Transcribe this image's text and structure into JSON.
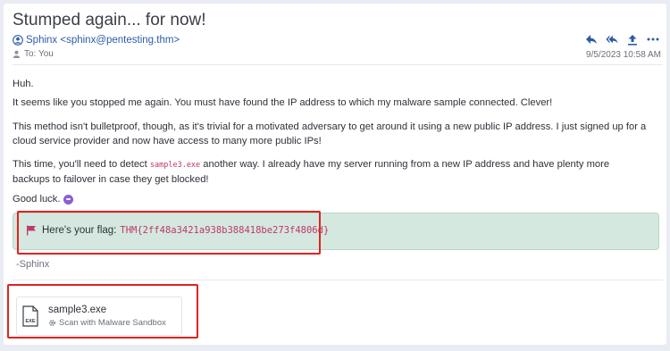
{
  "email": {
    "subject": "Stumped again... for now!",
    "sender": "Sphinx <sphinx@pentesting.thm>",
    "to_label": "To: You",
    "date": "9/5/2023 10:58 AM"
  },
  "actions": {
    "reply": "reply-icon",
    "reply_all": "reply-all-icon",
    "forward": "forward-icon",
    "more": "more-icon"
  },
  "body": {
    "p1": "Huh.",
    "p2": "It seems like you stopped me again. You must have found the IP address to which my malware sample connected. Clever!",
    "p3": "This method isn't bulletproof, though, as it's trivial for a motivated adversary to get around it using a new public IP address. I just signed up for a cloud service provider and now have access to many more public IPs!",
    "p4_before": "This time, you'll need to detect ",
    "p4_code": "sample3.exe",
    "p4_after": " another way. I already have my server running from a new IP address and have plenty more backups to failover in case they get blocked!",
    "p5": "Good luck."
  },
  "flag": {
    "label": "Here's your flag:",
    "value": "THM{2ff48a3421a938b388418be273f4806d}",
    "color": "#c0366b"
  },
  "signoff": "-Sphinx",
  "attachment": {
    "filename": "sample3.exe",
    "icon_label": "EXE",
    "scan_label": "Scan with Malware Sandbox"
  },
  "colors": {
    "link": "#2d5aa8",
    "flag_bg": "#d4e8df",
    "highlight": "#e0221f"
  }
}
